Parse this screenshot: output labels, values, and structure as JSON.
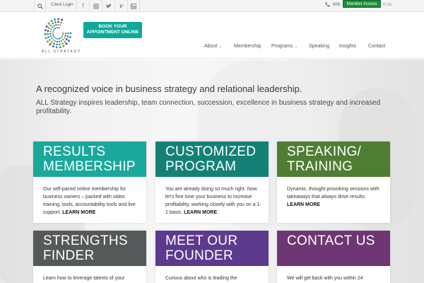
{
  "topbar": {
    "client_login": "Client Login",
    "phone": "806.",
    "member_access": "Member Access",
    "contact_us_fragment": "n Us",
    "icons": [
      "search-icon",
      "facebook-icon",
      "instagram-icon",
      "twitter-icon",
      "vimeo-icon",
      "linkedin-icon",
      "phone-icon"
    ]
  },
  "header": {
    "logo_text": "ALL STRATEGY",
    "book_button": "BOOK YOUR APPOINTMENT ONLINE",
    "nav": [
      {
        "label": "About",
        "has_dropdown": true
      },
      {
        "label": "Membership",
        "has_dropdown": false
      },
      {
        "label": "Programs",
        "has_dropdown": true
      },
      {
        "label": "Speaking",
        "has_dropdown": false
      },
      {
        "label": "Insights",
        "has_dropdown": false
      },
      {
        "label": "Contact",
        "has_dropdown": false
      }
    ]
  },
  "hero": {
    "tagline": "A recognized voice in business strategy and relational leadership.",
    "intro": "ALL Strategy inspires leadership, team connection, succession, excellence in business strategy and increased profitability."
  },
  "cards": [
    {
      "title": "RESULTS MEMBERSHIP",
      "body": "Our self-paced online membership for business owners – packed with video training, tools, accountability tools and live support.",
      "link": "LEARN MORE",
      "color": "#1aa89c"
    },
    {
      "title": "CUSTOMIZED PROGRAM",
      "body": "You are already doing so much right. Now let's fine tune your business to increase profitability, working closely with you on a 1-1 basis.",
      "link": "LEARN MORE",
      "color": "#148177"
    },
    {
      "title": "SPEAKING/ TRAINING",
      "body": "Dynamic, thought provoking sessions with takeaways that always drive results.",
      "link": "LEARN MORE",
      "color": "#4f7d34"
    },
    {
      "title": "STRENGTHS FINDER",
      "body": "Learn how to leverage talents of your",
      "link": "",
      "color": "#56595a"
    },
    {
      "title": "MEET OUR FOUNDER",
      "body": "Curious about who is leading the",
      "link": "",
      "color": "#5c3b8e"
    },
    {
      "title": "CONTACT US",
      "body": "We will get back with you within 24",
      "link": "",
      "color": "#6e3773"
    }
  ]
}
